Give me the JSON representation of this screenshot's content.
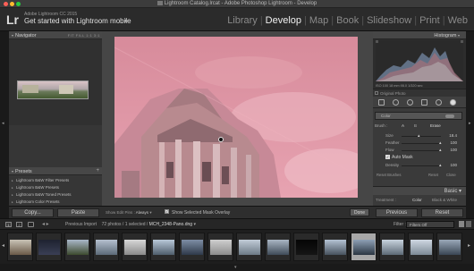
{
  "window": {
    "title": "Lightroom Catalog.lrcat - Adobe Photoshop Lightroom - Develop"
  },
  "identity": {
    "logo": "Lr",
    "subtitle": "Adobe Lightroom CC 2015",
    "main": "Get started with Lightroom mobile",
    "chevron": "▸"
  },
  "modules": {
    "items": [
      "Library",
      "Develop",
      "Map",
      "Book",
      "Slideshow",
      "Print",
      "Web"
    ],
    "active": "Develop",
    "separator": "|"
  },
  "left_panel": {
    "navigator_label": "Navigator",
    "zoom_options": "FIT  FILL  1:1  3:1",
    "presets_label": "Presets",
    "presets": [
      "Lightroom B&W Filter Presets",
      "Lightroom B&W Presets",
      "Lightroom B&W Toned Presets",
      "Lightroom Color Presets",
      "Lightroom Effect Presets",
      "Lightroom General Presets",
      "Lightroom Video Presets",
      "User Presets"
    ],
    "copy_label": "Copy...",
    "paste_label": "Paste"
  },
  "toolbar": {
    "show_edit_pins_label": "Show Edit Pins :",
    "show_edit_pins_value": "Always",
    "show_mask_overlay_label": "Show Selected Mask Overlay",
    "done_label": "Done"
  },
  "right_panel": {
    "histogram_label": "Histogram",
    "histo_meta": "ISO 100   18 mm   f/8.0   1/320 sec",
    "original_photo_label": "Original Photo",
    "mask_label": "Color",
    "brush_label": "Brush :",
    "brush_a": "A",
    "brush_b": "B",
    "brush_erase": "Erase",
    "size_label": "Size",
    "size_value": "18.4",
    "feather_label": "Feather",
    "feather_value": "100",
    "flow_label": "Flow",
    "flow_value": "100",
    "auto_mask_label": "Auto Mask",
    "density_label": "Density",
    "density_value": "100",
    "reset_brushes_label": "Reset Brushes",
    "reset_label": "Reset",
    "close_label": "Close",
    "basic_label": "Basic",
    "treatment_label": "Treatment :",
    "treatment_color": "Color",
    "treatment_bw": "Black & White",
    "previous_label": "Previous",
    "reset_button_label": "Reset"
  },
  "filmstrip_bar": {
    "square_1": "1",
    "square_2": "2",
    "arrows": "◂ ▸",
    "source": "Previous Import",
    "count": "72 photos / 1 selected /",
    "filename": "MCH_2348-Pano.dng",
    "filter_label": "Filter :",
    "filter_value": "Filters Off"
  },
  "filmstrip": {
    "thumbs": [
      {
        "top": "#c9c3b6",
        "bottom": "#6b5a48",
        "active": false
      },
      {
        "top": "#1e2230",
        "bottom": "#3a3f55",
        "active": false
      },
      {
        "top": "#a9b7c9",
        "bottom": "#3d4a2e",
        "active": false
      },
      {
        "top": "#b5c0cf",
        "bottom": "#5c6a78",
        "active": false
      },
      {
        "top": "#d8d8d8",
        "bottom": "#8a8a8a",
        "active": false
      },
      {
        "top": "#b8c7d8",
        "bottom": "#4f5e6c",
        "active": false
      },
      {
        "top": "#7e8ea5",
        "bottom": "#2f3a4a",
        "active": false
      },
      {
        "top": "#cfcfcf",
        "bottom": "#8c8c8c",
        "active": false
      },
      {
        "top": "#c2ccd8",
        "bottom": "#6d7a86",
        "active": false
      },
      {
        "top": "#aab6c4",
        "bottom": "#3f4b58",
        "active": false
      },
      {
        "top": "#050505",
        "bottom": "#151515",
        "active": false
      },
      {
        "top": "#b4c2d3",
        "bottom": "#47525e",
        "active": false
      },
      {
        "top": "#8ea0b5",
        "bottom": "#2b3642",
        "active": true
      },
      {
        "top": "#c8d3de",
        "bottom": "#5d6a76",
        "active": false
      },
      {
        "top": "#cfd8e2",
        "bottom": "#7d8a96",
        "active": false
      },
      {
        "top": "#9aa8b8",
        "bottom": "#3a4654",
        "active": false
      }
    ]
  },
  "colors": {
    "active_module": "#f0f0f0",
    "mask_overlay": "#dc8e9e"
  }
}
